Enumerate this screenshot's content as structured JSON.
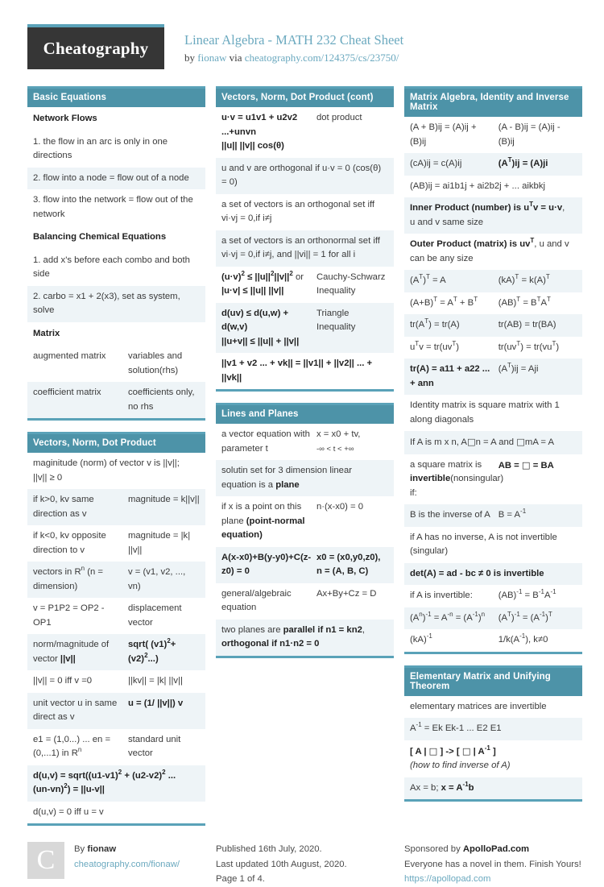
{
  "header": {
    "logo_text": "Cheatography",
    "title": "Linear Algebra - MATH 232 Cheat Sheet",
    "by_prefix": "by ",
    "author": "fionaw",
    "via": " via ",
    "source_url": "cheatography.com/124375/cs/23750/"
  },
  "colors": {
    "accent": "#4d93a8",
    "rule": "#5aa2b8",
    "link": "#6ba9bf",
    "stripe": "#eef4f7"
  },
  "columns": [
    {
      "blocks": [
        {
          "title": "Basic Equations",
          "rows": [
            {
              "type": "sub",
              "c1": "Network Flows"
            },
            {
              "type": "full",
              "c1": "1. the flow in an arc is only in one directions"
            },
            {
              "type": "full",
              "c1": "2. flow into a node = flow out of a node"
            },
            {
              "type": "full",
              "c1": "3. flow into the network = flow out of the network"
            },
            {
              "type": "sub",
              "c1": "Balancing Chemical Equations"
            },
            {
              "type": "full",
              "c1": "1. add x's before each combo and both side"
            },
            {
              "type": "full",
              "c1": "2. carbo = x1 + 2(x3), set as system, solve"
            },
            {
              "type": "sub",
              "c1": "Matrix"
            },
            {
              "type": "pair",
              "c1": "augmented matrix",
              "c2": "variables and soluti­on(rhs)"
            },
            {
              "type": "pair",
              "c1": "coefficient matrix",
              "c2": "coefficients only, no rhs"
            }
          ]
        },
        {
          "title": "Vectors, Norm, Dot Product",
          "rows": [
            {
              "type": "full",
              "c1": "maginitude (norm) of vector v is ||v||; ||v|| ≥ 0"
            },
            {
              "type": "pair",
              "c1": "if k>0, kv same direction as v",
              "c2": "magnitude = k||v||"
            },
            {
              "type": "pair",
              "c1": "if k<0, kv opposite direction to v",
              "c2": "magnitude = |k| ||v||"
            },
            {
              "type": "pair",
              "c1": "vectors in R<sup>n</sup> (n = dimension)",
              "c2": "v = (v1, v2, ..., vn)"
            },
            {
              "type": "pair",
              "c1": "v = P1P2 = OP2 - OP1",
              "c2": "displacement vector"
            },
            {
              "type": "pair",
              "c1": "norm/magnitude of vector <b>||v||</b>",
              "c2": "<b>sqrt( (v1)<sup>2</sup>+ (v2)<sup>2</sup>...)</b>"
            },
            {
              "type": "pair",
              "c1": "||v|| = 0 iff v =0",
              "c2": "||kv|| = |k| ||v||"
            },
            {
              "type": "pair",
              "c1": "unit vector u in same direct as v",
              "c2": "<b>u = (1/ ||v||) v</b>"
            },
            {
              "type": "pair",
              "c1": "e1 = (1,0...) ... en = (0,...1) in R<sup>n</sup>",
              "c2": "standard unit vector"
            },
            {
              "type": "full",
              "c1": "<b>d(u,v) = sqrt((u1-v1)<sup>2</sup> + (u2-v2)<sup>2</sup> ... (un-vn)<sup>2</sup>) = ||u-v||</b>"
            },
            {
              "type": "full",
              "c1": "d(u,v) = 0 iff u = v"
            }
          ]
        }
      ]
    },
    {
      "blocks": [
        {
          "title": "Vectors, Norm, Dot Product (cont)",
          "rows": [
            {
              "type": "pair",
              "c1": "<b>u·v = u1v1 + u2v2 ...+unvn</b><br><b>||u|| ||v|| cos(θ)</b>",
              "c2": "dot product"
            },
            {
              "type": "full",
              "c1": "u and v are orthogonal if u·v = 0 (cos(θ) = 0)"
            },
            {
              "type": "full",
              "c1": "a set of vectors is an orthogonal set iff vi·vj = 0,if i≠j"
            },
            {
              "type": "full",
              "c1": "a set of vectors is an orthonormal set iff vi·vj = 0,if i≠j, and ||vi|| = 1 for all i"
            },
            {
              "type": "pair",
              "c1": "<b>(u·v)<sup>2</sup> ≤ ||u||<sup>2</sup>||v||<sup>2</sup></b> or <b>|u·v| ≤ ||u|| ||v||</b>",
              "c2": "Cauchy-Schwarz Inequality"
            },
            {
              "type": "pair",
              "c1": "<b>d(uv) ≤ d(u,w) + d(w,v)</b><br><b>||u+v|| ≤ ||u|| + ||v||</b>",
              "c2": "Triangle Inequality"
            },
            {
              "type": "full",
              "c1": "<b>||v1 + v2 ... + vk|| = ||v1|| + ||v2|| ... + ||vk||</b>"
            }
          ]
        },
        {
          "title": "Lines and Planes",
          "rows": [
            {
              "type": "pair",
              "c1": "a vector equation with parameter t",
              "c2": "x = x0 + tv,<br><span style='font-size:9.5px'>-∞ &lt; t &lt; +∞</span>"
            },
            {
              "type": "full",
              "c1": "solutin set for 3 dimension linear equation is a <b>plane</b>"
            },
            {
              "type": "pair",
              "c1": "if x is a point on this plane <b>(point-normal equation)</b>",
              "c2": "n·(x-x0) = 0"
            },
            {
              "type": "pair",
              "c1": "<b>A(x-x0)+B(y-y0)+C(z-z0) = 0</b>",
              "c2": "<b>x0 = (x0,y0,z0), n = (A, B, C)</b>"
            },
            {
              "type": "pair",
              "c1": "general/algebraic equation",
              "c2": "Ax+By+Cz = D"
            },
            {
              "type": "full",
              "c1": "two planes are <b>parallel if n1 = kn2</b>, <b>orthogonal if n1·n2 = 0</b>"
            }
          ]
        }
      ]
    },
    {
      "blocks": [
        {
          "title": "Matrix Algebra, Identity and Inverse Matrix",
          "rows": [
            {
              "type": "pair",
              "c1": "(A + B)ij = (A)ij + (B)ij",
              "c2": "(A - B)ij = (A)ij - (B)ij"
            },
            {
              "type": "pair",
              "c1": "(cA)ij = c(A)ij",
              "c2": "<b>(A<sup>T</sup>)ij = (A)ji</b>"
            },
            {
              "type": "full",
              "c1": "(AB)ij = ai1b1j + ai2b2j + ... aikbkj"
            },
            {
              "type": "full",
              "c1": "<b>Inner Product (number) is u<sup>T</sup>v = u·v</b>, u and v same size"
            },
            {
              "type": "full",
              "c1": "<b>Outer Product (matrix) is uv<sup>T</sup></b>, u and v can be any size"
            },
            {
              "type": "pair",
              "c1": "(A<sup>T</sup>)<sup>T</sup> = A",
              "c2": "(kA)<sup>T</sup> = k(A)<sup>T</sup>"
            },
            {
              "type": "pair",
              "c1": "(A+B)<sup>T</sup> = A<sup>T</sup> + B<sup>T</sup>",
              "c2": "(AB)<sup>T</sup> = B<sup>T</sup>A<sup>T</sup>"
            },
            {
              "type": "pair",
              "c1": "tr(A<sup>T</sup>) = tr(A)",
              "c2": "tr(AB) = tr(BA)"
            },
            {
              "type": "pair",
              "c1": "u<sup>T</sup>v = tr(uv<sup>T</sup>)",
              "c2": "tr(uv<sup>T</sup>) = tr(vu<sup>T</sup>)"
            },
            {
              "type": "pair",
              "c1": "<b>tr(A) = a11 + a22 ... + ann</b>",
              "c2": "(A<sup>T</sup>)ij = Aji"
            },
            {
              "type": "full",
              "c1": "Identity matrix is square matrix with 1 along diagonals"
            },
            {
              "type": "full",
              "c1": "If A is m x n, A<span class='box'>□</span>n = A and <span class='box'>□</span>mA = A"
            },
            {
              "type": "pair",
              "c1": "a square matrix is <b>invertible</b>(nonsingular) if:",
              "c2": "<b>AB = <span class='box'>□</span> = BA</b>"
            },
            {
              "type": "pair",
              "c1": "B is the inverse of A",
              "c2": "B = A<sup>-1</sup>"
            },
            {
              "type": "full",
              "c1": "if A has no inverse, A is not invertible (singular)"
            },
            {
              "type": "full",
              "c1": "<b>det(A) = ad - bc ≠ 0 is invertible</b>"
            },
            {
              "type": "pair",
              "c1": "if A is invertible:",
              "c2": "(AB)<sup>-1</sup> = B<sup>-1</sup>A<sup>-1</sup>"
            },
            {
              "type": "pair",
              "c1": "(A<sup>n</sup>)<sup>-1</sup> = A<sup>-n</sup> = (A<sup>-1</sup>)<sup>n</sup>",
              "c2": "(A<sup>T</sup>)<sup>-1</sup> = (A<sup>-1</sup>)<sup>T</sup>"
            },
            {
              "type": "pair",
              "c1": "(kA)<sup>-1</sup>",
              "c2": "1/k(A<sup>-1</sup>), k≠0"
            }
          ]
        },
        {
          "title": "Elementary Matrix and Unifying Theorem",
          "rows": [
            {
              "type": "full",
              "c1": "elementary matrices are invertible"
            },
            {
              "type": "full",
              "c1": "A<sup>-1</sup> = Ek Ek-1 ...  E2 E1"
            },
            {
              "type": "full",
              "c1": "<b>[ A | <span class='box'>□</span> ] -&gt; [ <span class='box'>□</span> | A<sup>-1</sup> ]</b><br><i>(how to find inverse of A)</i>"
            },
            {
              "type": "full",
              "c1": "Ax = b; <b>x = A<sup>-1</sup>b</b>"
            }
          ]
        }
      ]
    }
  ],
  "footer": {
    "avatar_letter": "C",
    "by_label": "By ",
    "author": "fionaw",
    "author_url": "cheatography.com/fionaw/",
    "published": "Published 16th July, 2020.",
    "updated": "Last updated 10th August, 2020.",
    "page": "Page 1 of 4.",
    "sponsor_prefix": "Sponsored by ",
    "sponsor_name": "ApolloPad.com",
    "sponsor_tagline": "Everyone has a novel in them. Finish Yours!",
    "sponsor_url": "https://apollopad.com"
  }
}
